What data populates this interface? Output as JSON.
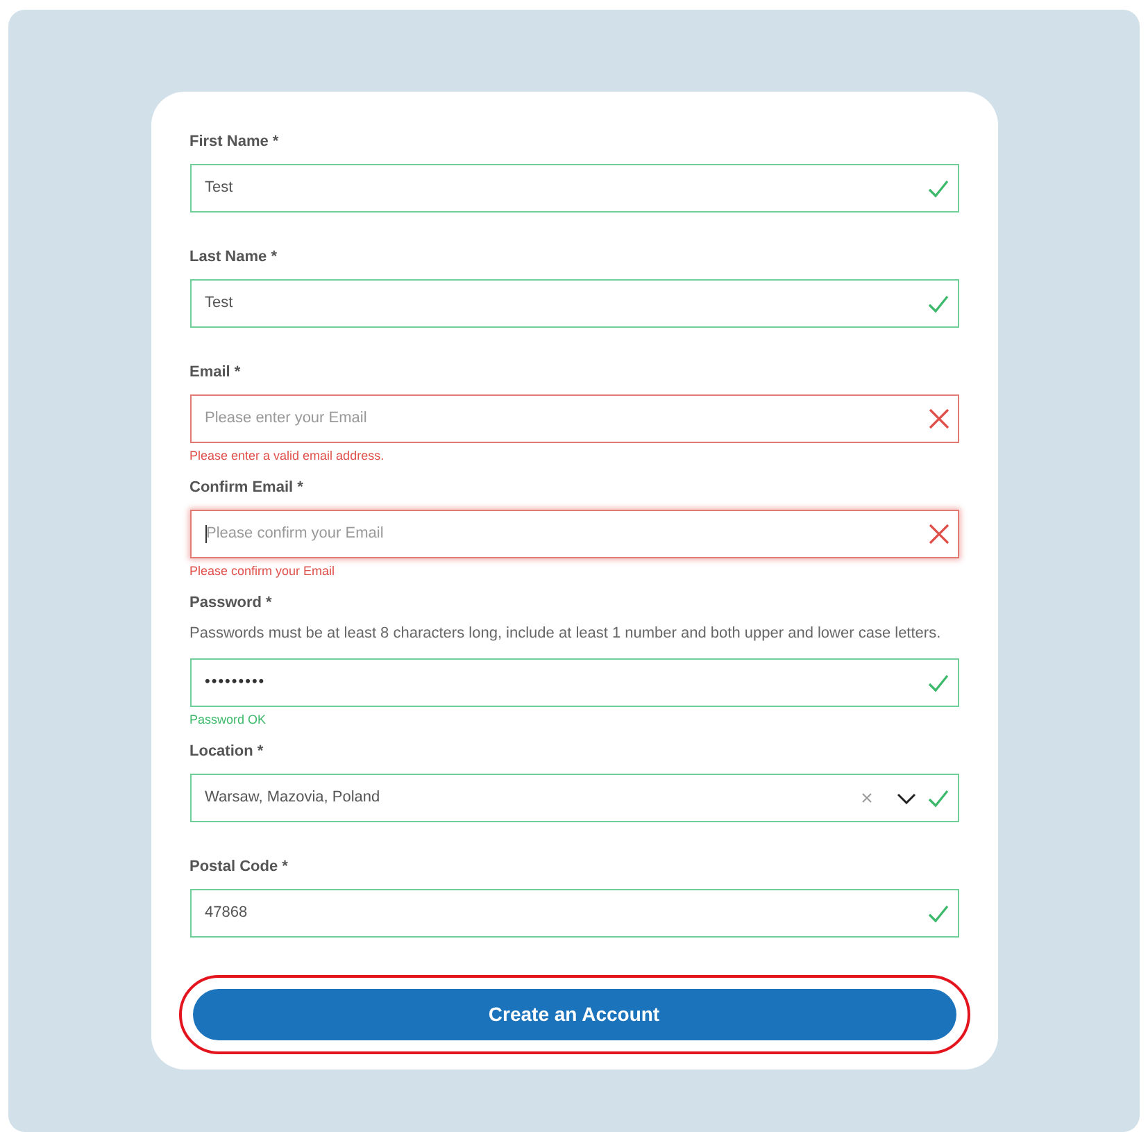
{
  "form": {
    "fields": [
      {
        "kind": "text",
        "label": "First Name *",
        "value": "Test",
        "valid": true,
        "focused": false
      },
      {
        "kind": "text",
        "label": "Last Name *",
        "value": "Test",
        "valid": true,
        "focused": false
      },
      {
        "kind": "text",
        "label": "Email *",
        "placeholder": "Please enter your Email",
        "valid": false,
        "message": "Please enter a valid email address.",
        "focused": false
      },
      {
        "kind": "text",
        "label": "Confirm Email *",
        "placeholder": "Please confirm your Email",
        "valid": false,
        "message": "Please confirm your Email",
        "focused": true
      },
      {
        "kind": "password",
        "label": "Password *",
        "hint": "Passwords must be at least 8 characters long, include at least 1 number and both upper and lower case letters.",
        "value": "•••••••••",
        "valid": true,
        "message": "Password OK",
        "focused": false
      },
      {
        "kind": "select",
        "label": "Location *",
        "value": "Warsaw, Mazovia, Poland",
        "valid": true,
        "focused": false
      },
      {
        "kind": "text",
        "label": "Postal Code *",
        "value": "47868",
        "valid": true,
        "focused": false
      }
    ],
    "submit": {
      "label": "Create an Account",
      "highlighted": true
    }
  }
}
